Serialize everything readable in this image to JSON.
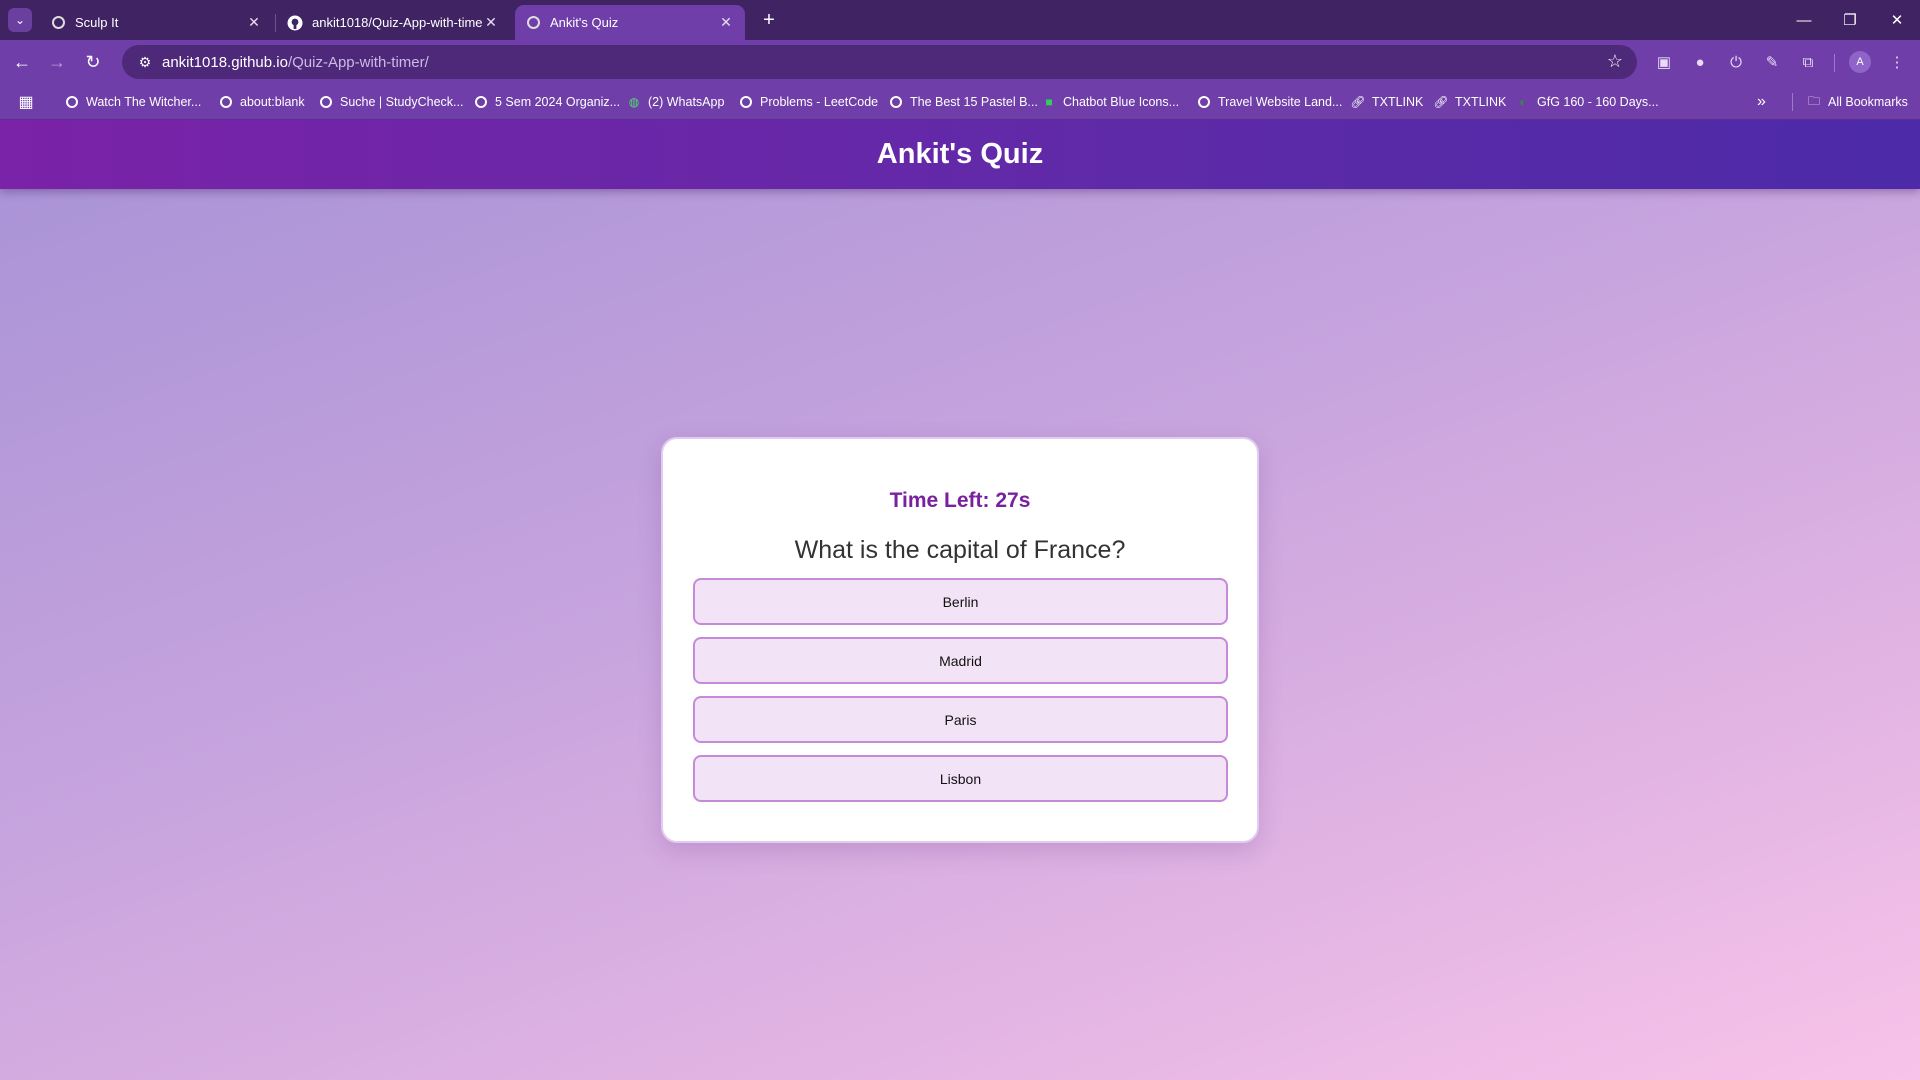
{
  "browser": {
    "tabs": [
      {
        "title": "Sculp It",
        "icon": "globe-icon"
      },
      {
        "title": "ankit1018/Quiz-App-with-timer",
        "icon": "github-icon"
      },
      {
        "title": "Ankit's Quiz",
        "icon": "globe-icon",
        "active": true
      }
    ],
    "url_host": "ankit1018.github.io",
    "url_path": "/Quiz-App-with-timer/",
    "avatar_letter": "A",
    "bookmarks": [
      "Watch The Witcher...",
      "about:blank",
      "Suche | StudyCheck...",
      "5 Sem 2024 Organiz...",
      "(2) WhatsApp",
      "Problems - LeetCode",
      "The Best 15 Pastel B...",
      "Chatbot Blue Icons...",
      "Travel Website Land...",
      "TXTLINK",
      "TXTLINK",
      "GfG 160 - 160 Days..."
    ],
    "all_bookmarks_label": "All Bookmarks",
    "more_label": "»"
  },
  "quiz": {
    "header_title": "Ankit's Quiz",
    "timer_text": "Time Left: 27s",
    "question": "What is the capital of France?",
    "options": [
      "Berlin",
      "Madrid",
      "Paris",
      "Lisbon"
    ]
  },
  "colors": {
    "header_gradient_start": "#7a22a8",
    "header_gradient_end": "#4c2aa8",
    "timer": "#7a1fa0",
    "option_bg": "#f3e3f6",
    "option_border": "#c58ad8"
  }
}
